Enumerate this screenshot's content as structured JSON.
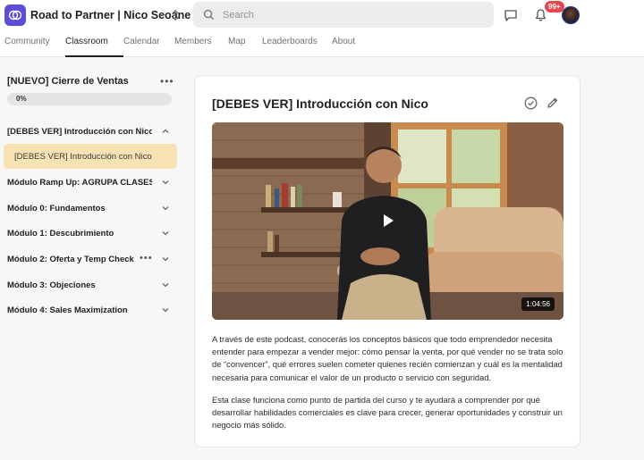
{
  "header": {
    "community_name": "Road to Partner | Nico Seoane",
    "search_placeholder": "Search",
    "notifications_badge": "99+"
  },
  "nav": {
    "tabs": [
      {
        "label": "Community",
        "active": false
      },
      {
        "label": "Classroom",
        "active": true
      },
      {
        "label": "Calendar",
        "active": false
      },
      {
        "label": "Members",
        "active": false
      },
      {
        "label": "Map",
        "active": false
      },
      {
        "label": "Leaderboards",
        "active": false
      },
      {
        "label": "About",
        "active": false
      }
    ]
  },
  "sidebar": {
    "course_title": "[NUEVO] Cierre de Ventas",
    "progress_label": "0%",
    "progress_value": 0,
    "modules": [
      {
        "label": "[DEBES VER] Introducción con Nico",
        "expanded": true
      },
      {
        "label": "Módulo Ramp Up: AGRUPA CLASES...",
        "expanded": false
      },
      {
        "label": "Módulo 0: Fundamentos",
        "expanded": false
      },
      {
        "label": "Módulo 1: Descubrimiento",
        "expanded": false
      },
      {
        "label": "Módulo 2: Oferta y Temp Check",
        "expanded": false
      },
      {
        "label": "Módulo 3: Objeciones",
        "expanded": false
      },
      {
        "label": "Módulo 4: Sales Maximization",
        "expanded": false
      }
    ],
    "active_lesson": "[DEBES VER] Introducción con Nico"
  },
  "lesson": {
    "title": "[DEBES VER] Introducción con Nico",
    "video_duration": "1:04:56",
    "paragraphs": [
      "A través de este podcast, conocerás los conceptos básicos que todo emprendedor necesita entender para empezar a vender mejor: cómo pensar la venta, por qué vender no se trata solo de “convencer”, qué errores suelen cometer quienes recién comienzan y cuál es la mentalidad necesaria para comunicar el valor de un producto o servicio con seguridad.",
      "Esta clase funciona como punto de partida del curso y te ayudará a comprender por qué desarrollar habilidades comerciales es clave para crecer, generar oportunidades y construir un negocio más sólido."
    ]
  },
  "colors": {
    "brand": "#5a4fd6",
    "active_lesson_bg": "#f7e2b4",
    "badge": "#e5484d"
  }
}
